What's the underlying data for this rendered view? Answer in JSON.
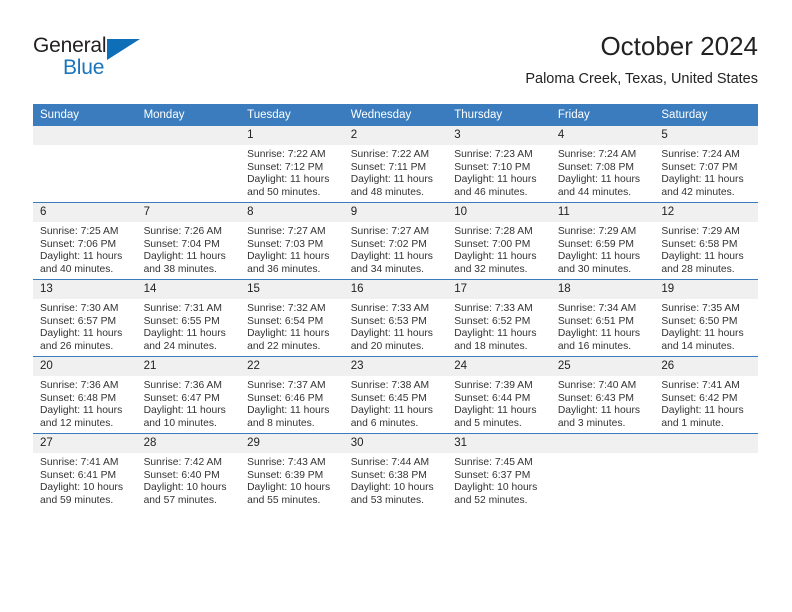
{
  "brand": {
    "name_part1": "General",
    "name_part2": "Blue",
    "accent_color": "#1b75bb",
    "triangle_color": "#0e6eb8"
  },
  "header": {
    "title": "October 2024",
    "subtitle": "Paloma Creek, Texas, United States"
  },
  "calendar": {
    "header_bg": "#3a7cbe",
    "daynum_bg": "#f0f0f0",
    "weekdays": [
      "Sunday",
      "Monday",
      "Tuesday",
      "Wednesday",
      "Thursday",
      "Friday",
      "Saturday"
    ],
    "weeks": [
      [
        {
          "day": "",
          "empty": true,
          "lines": []
        },
        {
          "day": "",
          "empty": true,
          "lines": []
        },
        {
          "day": "1",
          "lines": [
            "Sunrise: 7:22 AM",
            "Sunset: 7:12 PM",
            "Daylight: 11 hours",
            "and 50 minutes."
          ]
        },
        {
          "day": "2",
          "lines": [
            "Sunrise: 7:22 AM",
            "Sunset: 7:11 PM",
            "Daylight: 11 hours",
            "and 48 minutes."
          ]
        },
        {
          "day": "3",
          "lines": [
            "Sunrise: 7:23 AM",
            "Sunset: 7:10 PM",
            "Daylight: 11 hours",
            "and 46 minutes."
          ]
        },
        {
          "day": "4",
          "lines": [
            "Sunrise: 7:24 AM",
            "Sunset: 7:08 PM",
            "Daylight: 11 hours",
            "and 44 minutes."
          ]
        },
        {
          "day": "5",
          "lines": [
            "Sunrise: 7:24 AM",
            "Sunset: 7:07 PM",
            "Daylight: 11 hours",
            "and 42 minutes."
          ]
        }
      ],
      [
        {
          "day": "6",
          "lines": [
            "Sunrise: 7:25 AM",
            "Sunset: 7:06 PM",
            "Daylight: 11 hours",
            "and 40 minutes."
          ]
        },
        {
          "day": "7",
          "lines": [
            "Sunrise: 7:26 AM",
            "Sunset: 7:04 PM",
            "Daylight: 11 hours",
            "and 38 minutes."
          ]
        },
        {
          "day": "8",
          "lines": [
            "Sunrise: 7:27 AM",
            "Sunset: 7:03 PM",
            "Daylight: 11 hours",
            "and 36 minutes."
          ]
        },
        {
          "day": "9",
          "lines": [
            "Sunrise: 7:27 AM",
            "Sunset: 7:02 PM",
            "Daylight: 11 hours",
            "and 34 minutes."
          ]
        },
        {
          "day": "10",
          "lines": [
            "Sunrise: 7:28 AM",
            "Sunset: 7:00 PM",
            "Daylight: 11 hours",
            "and 32 minutes."
          ]
        },
        {
          "day": "11",
          "lines": [
            "Sunrise: 7:29 AM",
            "Sunset: 6:59 PM",
            "Daylight: 11 hours",
            "and 30 minutes."
          ]
        },
        {
          "day": "12",
          "lines": [
            "Sunrise: 7:29 AM",
            "Sunset: 6:58 PM",
            "Daylight: 11 hours",
            "and 28 minutes."
          ]
        }
      ],
      [
        {
          "day": "13",
          "lines": [
            "Sunrise: 7:30 AM",
            "Sunset: 6:57 PM",
            "Daylight: 11 hours",
            "and 26 minutes."
          ]
        },
        {
          "day": "14",
          "lines": [
            "Sunrise: 7:31 AM",
            "Sunset: 6:55 PM",
            "Daylight: 11 hours",
            "and 24 minutes."
          ]
        },
        {
          "day": "15",
          "lines": [
            "Sunrise: 7:32 AM",
            "Sunset: 6:54 PM",
            "Daylight: 11 hours",
            "and 22 minutes."
          ]
        },
        {
          "day": "16",
          "lines": [
            "Sunrise: 7:33 AM",
            "Sunset: 6:53 PM",
            "Daylight: 11 hours",
            "and 20 minutes."
          ]
        },
        {
          "day": "17",
          "lines": [
            "Sunrise: 7:33 AM",
            "Sunset: 6:52 PM",
            "Daylight: 11 hours",
            "and 18 minutes."
          ]
        },
        {
          "day": "18",
          "lines": [
            "Sunrise: 7:34 AM",
            "Sunset: 6:51 PM",
            "Daylight: 11 hours",
            "and 16 minutes."
          ]
        },
        {
          "day": "19",
          "lines": [
            "Sunrise: 7:35 AM",
            "Sunset: 6:50 PM",
            "Daylight: 11 hours",
            "and 14 minutes."
          ]
        }
      ],
      [
        {
          "day": "20",
          "lines": [
            "Sunrise: 7:36 AM",
            "Sunset: 6:48 PM",
            "Daylight: 11 hours",
            "and 12 minutes."
          ]
        },
        {
          "day": "21",
          "lines": [
            "Sunrise: 7:36 AM",
            "Sunset: 6:47 PM",
            "Daylight: 11 hours",
            "and 10 minutes."
          ]
        },
        {
          "day": "22",
          "lines": [
            "Sunrise: 7:37 AM",
            "Sunset: 6:46 PM",
            "Daylight: 11 hours",
            "and 8 minutes."
          ]
        },
        {
          "day": "23",
          "lines": [
            "Sunrise: 7:38 AM",
            "Sunset: 6:45 PM",
            "Daylight: 11 hours",
            "and 6 minutes."
          ]
        },
        {
          "day": "24",
          "lines": [
            "Sunrise: 7:39 AM",
            "Sunset: 6:44 PM",
            "Daylight: 11 hours",
            "and 5 minutes."
          ]
        },
        {
          "day": "25",
          "lines": [
            "Sunrise: 7:40 AM",
            "Sunset: 6:43 PM",
            "Daylight: 11 hours",
            "and 3 minutes."
          ]
        },
        {
          "day": "26",
          "lines": [
            "Sunrise: 7:41 AM",
            "Sunset: 6:42 PM",
            "Daylight: 11 hours",
            "and 1 minute."
          ]
        }
      ],
      [
        {
          "day": "27",
          "lines": [
            "Sunrise: 7:41 AM",
            "Sunset: 6:41 PM",
            "Daylight: 10 hours",
            "and 59 minutes."
          ]
        },
        {
          "day": "28",
          "lines": [
            "Sunrise: 7:42 AM",
            "Sunset: 6:40 PM",
            "Daylight: 10 hours",
            "and 57 minutes."
          ]
        },
        {
          "day": "29",
          "lines": [
            "Sunrise: 7:43 AM",
            "Sunset: 6:39 PM",
            "Daylight: 10 hours",
            "and 55 minutes."
          ]
        },
        {
          "day": "30",
          "lines": [
            "Sunrise: 7:44 AM",
            "Sunset: 6:38 PM",
            "Daylight: 10 hours",
            "and 53 minutes."
          ]
        },
        {
          "day": "31",
          "lines": [
            "Sunrise: 7:45 AM",
            "Sunset: 6:37 PM",
            "Daylight: 10 hours",
            "and 52 minutes."
          ]
        },
        {
          "day": "",
          "empty": true,
          "lines": []
        },
        {
          "day": "",
          "empty": true,
          "lines": []
        }
      ]
    ]
  }
}
